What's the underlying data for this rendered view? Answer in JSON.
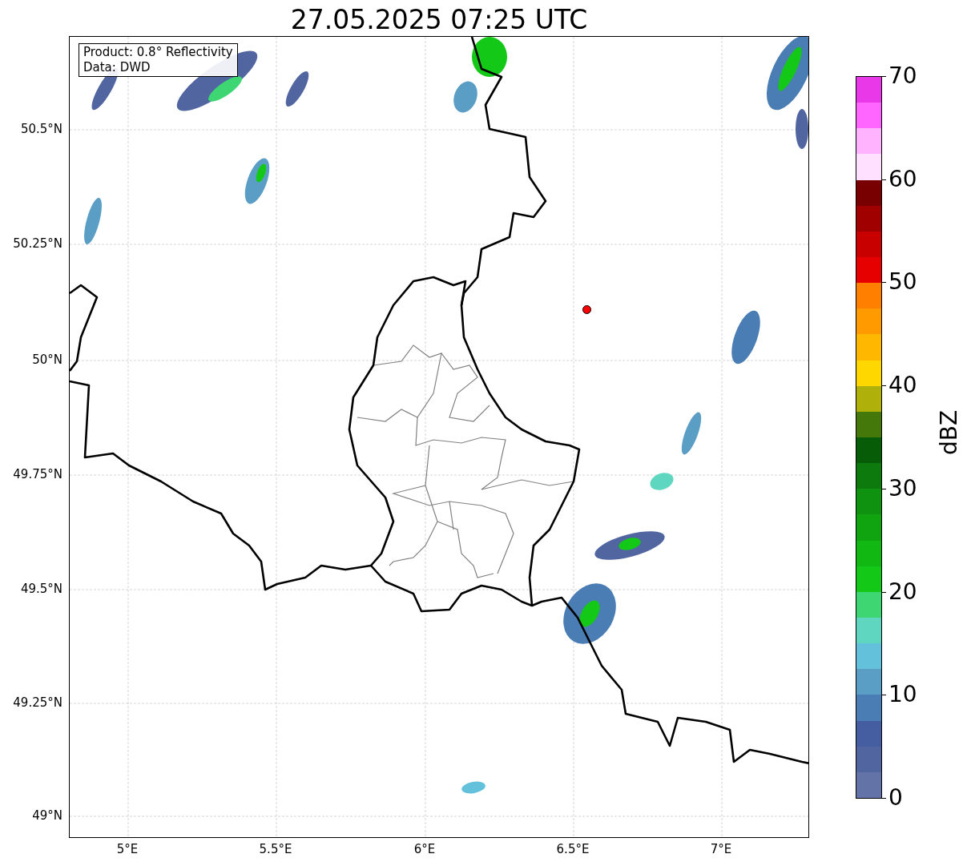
{
  "title": "27.05.2025 07:25 UTC",
  "info_box": [
    "Product: 0.8° Reflectivity",
    "Data: DWD"
  ],
  "y_ticks": [
    "50.5°N",
    "50.25°N",
    "50°N",
    "49.75°N",
    "49.5°N",
    "49.25°N",
    "49°N"
  ],
  "x_ticks": [
    "5°E",
    "5.5°E",
    "6°E",
    "6.5°E",
    "7°E"
  ],
  "colorbar": {
    "label": "dBZ",
    "ticks": [
      "70",
      "60",
      "50",
      "40",
      "30",
      "20",
      "10",
      "0"
    ],
    "bands": [
      {
        "color": "#e838e8"
      },
      {
        "color": "#ff66ff"
      },
      {
        "color": "#ffb3ff"
      },
      {
        "color": "#ffe0ff"
      },
      {
        "color": "#780000"
      },
      {
        "color": "#a00000"
      },
      {
        "color": "#c80000"
      },
      {
        "color": "#e60000"
      },
      {
        "color": "#ff7f00"
      },
      {
        "color": "#ff9b00"
      },
      {
        "color": "#ffb700"
      },
      {
        "color": "#ffd700"
      },
      {
        "color": "#b0b00a"
      },
      {
        "color": "#44780a"
      },
      {
        "color": "#075d07"
      },
      {
        "color": "#0c7a0c"
      },
      {
        "color": "#0f920f"
      },
      {
        "color": "#10a510"
      },
      {
        "color": "#12b812"
      },
      {
        "color": "#14c817"
      },
      {
        "color": "#3dd672"
      },
      {
        "color": "#5fd7c0"
      },
      {
        "color": "#64c1dc"
      },
      {
        "color": "#5b9ec5"
      },
      {
        "color": "#4a7db3"
      },
      {
        "color": "#445ea1"
      },
      {
        "color": "#5166a0"
      },
      {
        "color": "#6373a8"
      }
    ]
  }
}
